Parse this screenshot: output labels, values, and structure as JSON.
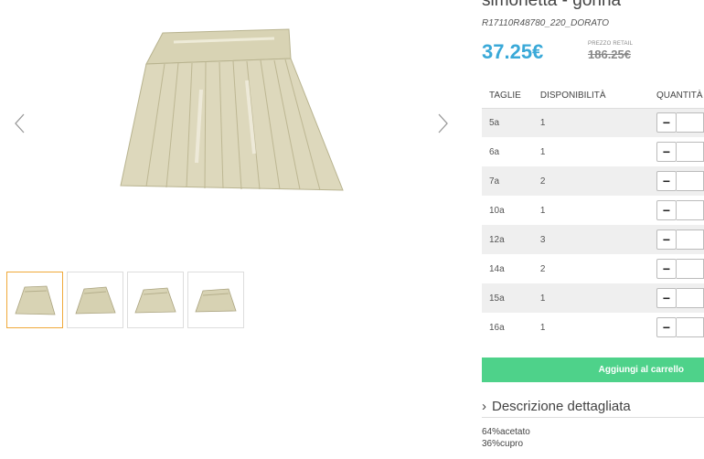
{
  "product": {
    "title": "simonetta - gonna",
    "sku": "R17110R48780_220_DORATO",
    "price": "37.25€",
    "retail_label": "PREZZO RETAIL",
    "retail_price": "186.25€"
  },
  "gallery": {
    "main_image": "skirt-photo",
    "prev_icon": "chevron-left-icon",
    "next_icon": "chevron-right-icon",
    "thumbnails": [
      "skirt-thumb-1",
      "skirt-thumb-2",
      "skirt-thumb-3",
      "skirt-thumb-4"
    ],
    "active_index": 0
  },
  "sizes": {
    "headers": [
      "TAGLIE",
      "DISPONIBILITÀ",
      "QUANTITÀ"
    ],
    "rows": [
      {
        "size": "5a",
        "available": "1"
      },
      {
        "size": "6a",
        "available": "1"
      },
      {
        "size": "7a",
        "available": "2"
      },
      {
        "size": "10a",
        "available": "1"
      },
      {
        "size": "12a",
        "available": "3"
      },
      {
        "size": "14a",
        "available": "2"
      },
      {
        "size": "15a",
        "available": "1"
      },
      {
        "size": "16a",
        "available": "1"
      }
    ],
    "minus_label": "−"
  },
  "cart": {
    "label": "Aggiungi al carrello"
  },
  "description": {
    "toggle_label": "Descrizione dettagliata",
    "composition": [
      "64%acetato",
      "36%cupro"
    ]
  },
  "colors": {
    "price": "#3aa9d8",
    "cart_button": "#4ed28a",
    "active_thumb": "#f0a93a"
  }
}
